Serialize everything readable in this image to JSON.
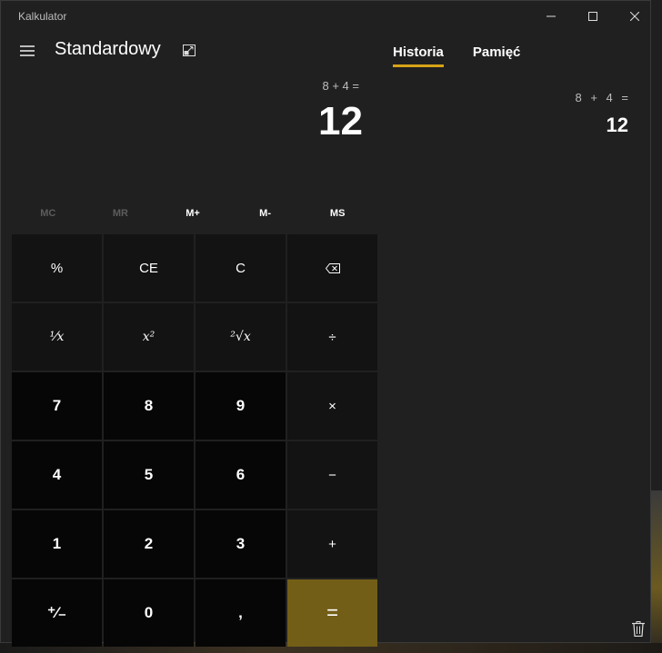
{
  "window": {
    "title": "Kalkulator"
  },
  "header": {
    "mode": "Standardowy"
  },
  "display": {
    "expression": "8 + 4 =",
    "result": "12"
  },
  "memory": {
    "buttons": [
      "MC",
      "MR",
      "M+",
      "M-",
      "MS"
    ]
  },
  "keys": {
    "percent": "%",
    "ce": "CE",
    "c": "C",
    "backspace": "⌫",
    "reciprocal": "¹⁄x",
    "square": "x²",
    "sqrt": "²√x",
    "divide": "÷",
    "seven": "7",
    "eight": "8",
    "nine": "9",
    "multiply": "×",
    "four": "4",
    "five": "5",
    "six": "6",
    "minus": "−",
    "one": "1",
    "two": "2",
    "three": "3",
    "plus": "+",
    "negate": "⁺⁄₋",
    "zero": "0",
    "decimal": ",",
    "equals": "="
  },
  "tabs": {
    "history": "Historia",
    "memory": "Pamięć"
  },
  "history": {
    "expression": "8 + 4 =",
    "result": "12"
  },
  "colors": {
    "accent": "#d6a316",
    "equals": "#725e17"
  },
  "icons": [
    "hamburger-icon",
    "keep-on-top-icon",
    "minimize-icon",
    "maximize-icon",
    "close-icon",
    "backspace-icon",
    "trash-icon"
  ]
}
